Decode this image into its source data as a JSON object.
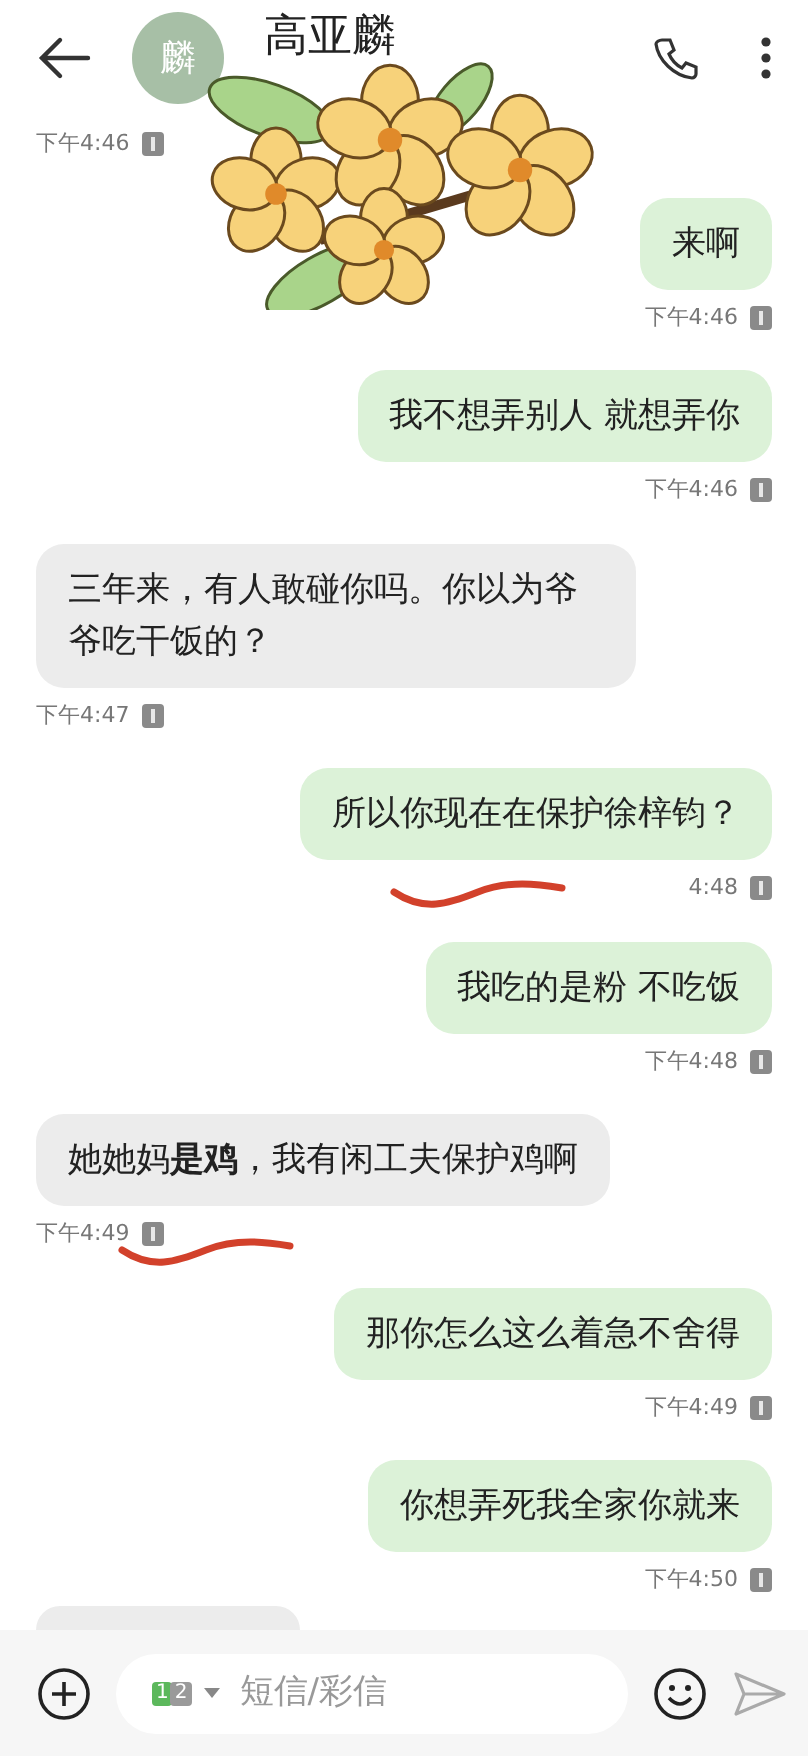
{
  "header": {
    "avatar": "麟",
    "name": "高亚麟"
  },
  "messages": [
    {
      "kind": "received",
      "time": "下午4:46",
      "underlined": false
    },
    {
      "kind": "sent",
      "text": "来啊",
      "time": "下午4:46",
      "underlined": false
    },
    {
      "kind": "sent",
      "text": "我不想弄别人 就想弄你",
      "time": "下午4:46",
      "underlined": false
    },
    {
      "kind": "received",
      "text": "三年来，有人敢碰你吗。你以为爷爷吃干饭的？",
      "time": "下午4:47",
      "underlined": false
    },
    {
      "kind": "sent",
      "text": "所以你现在在保护徐梓钧？",
      "time": "4:48",
      "underlined": true
    },
    {
      "kind": "sent",
      "text": "我吃的是粉 不吃饭",
      "time": "下午4:48",
      "underlined": false
    },
    {
      "kind": "received",
      "text": "她她妈**是鸡**，我有闲工夫保护鸡啊",
      "time": "下午4:49",
      "underlined": true
    },
    {
      "kind": "sent",
      "text": "那你怎么这么着急不舍得",
      "time": "下午4:49",
      "underlined": false
    },
    {
      "kind": "sent",
      "text": "你想弄死我全家你就来",
      "time": "下午4:50",
      "underlined": false
    }
  ],
  "composer": {
    "sim": [
      "1",
      "2"
    ],
    "placeholder": "短信/彩信"
  }
}
